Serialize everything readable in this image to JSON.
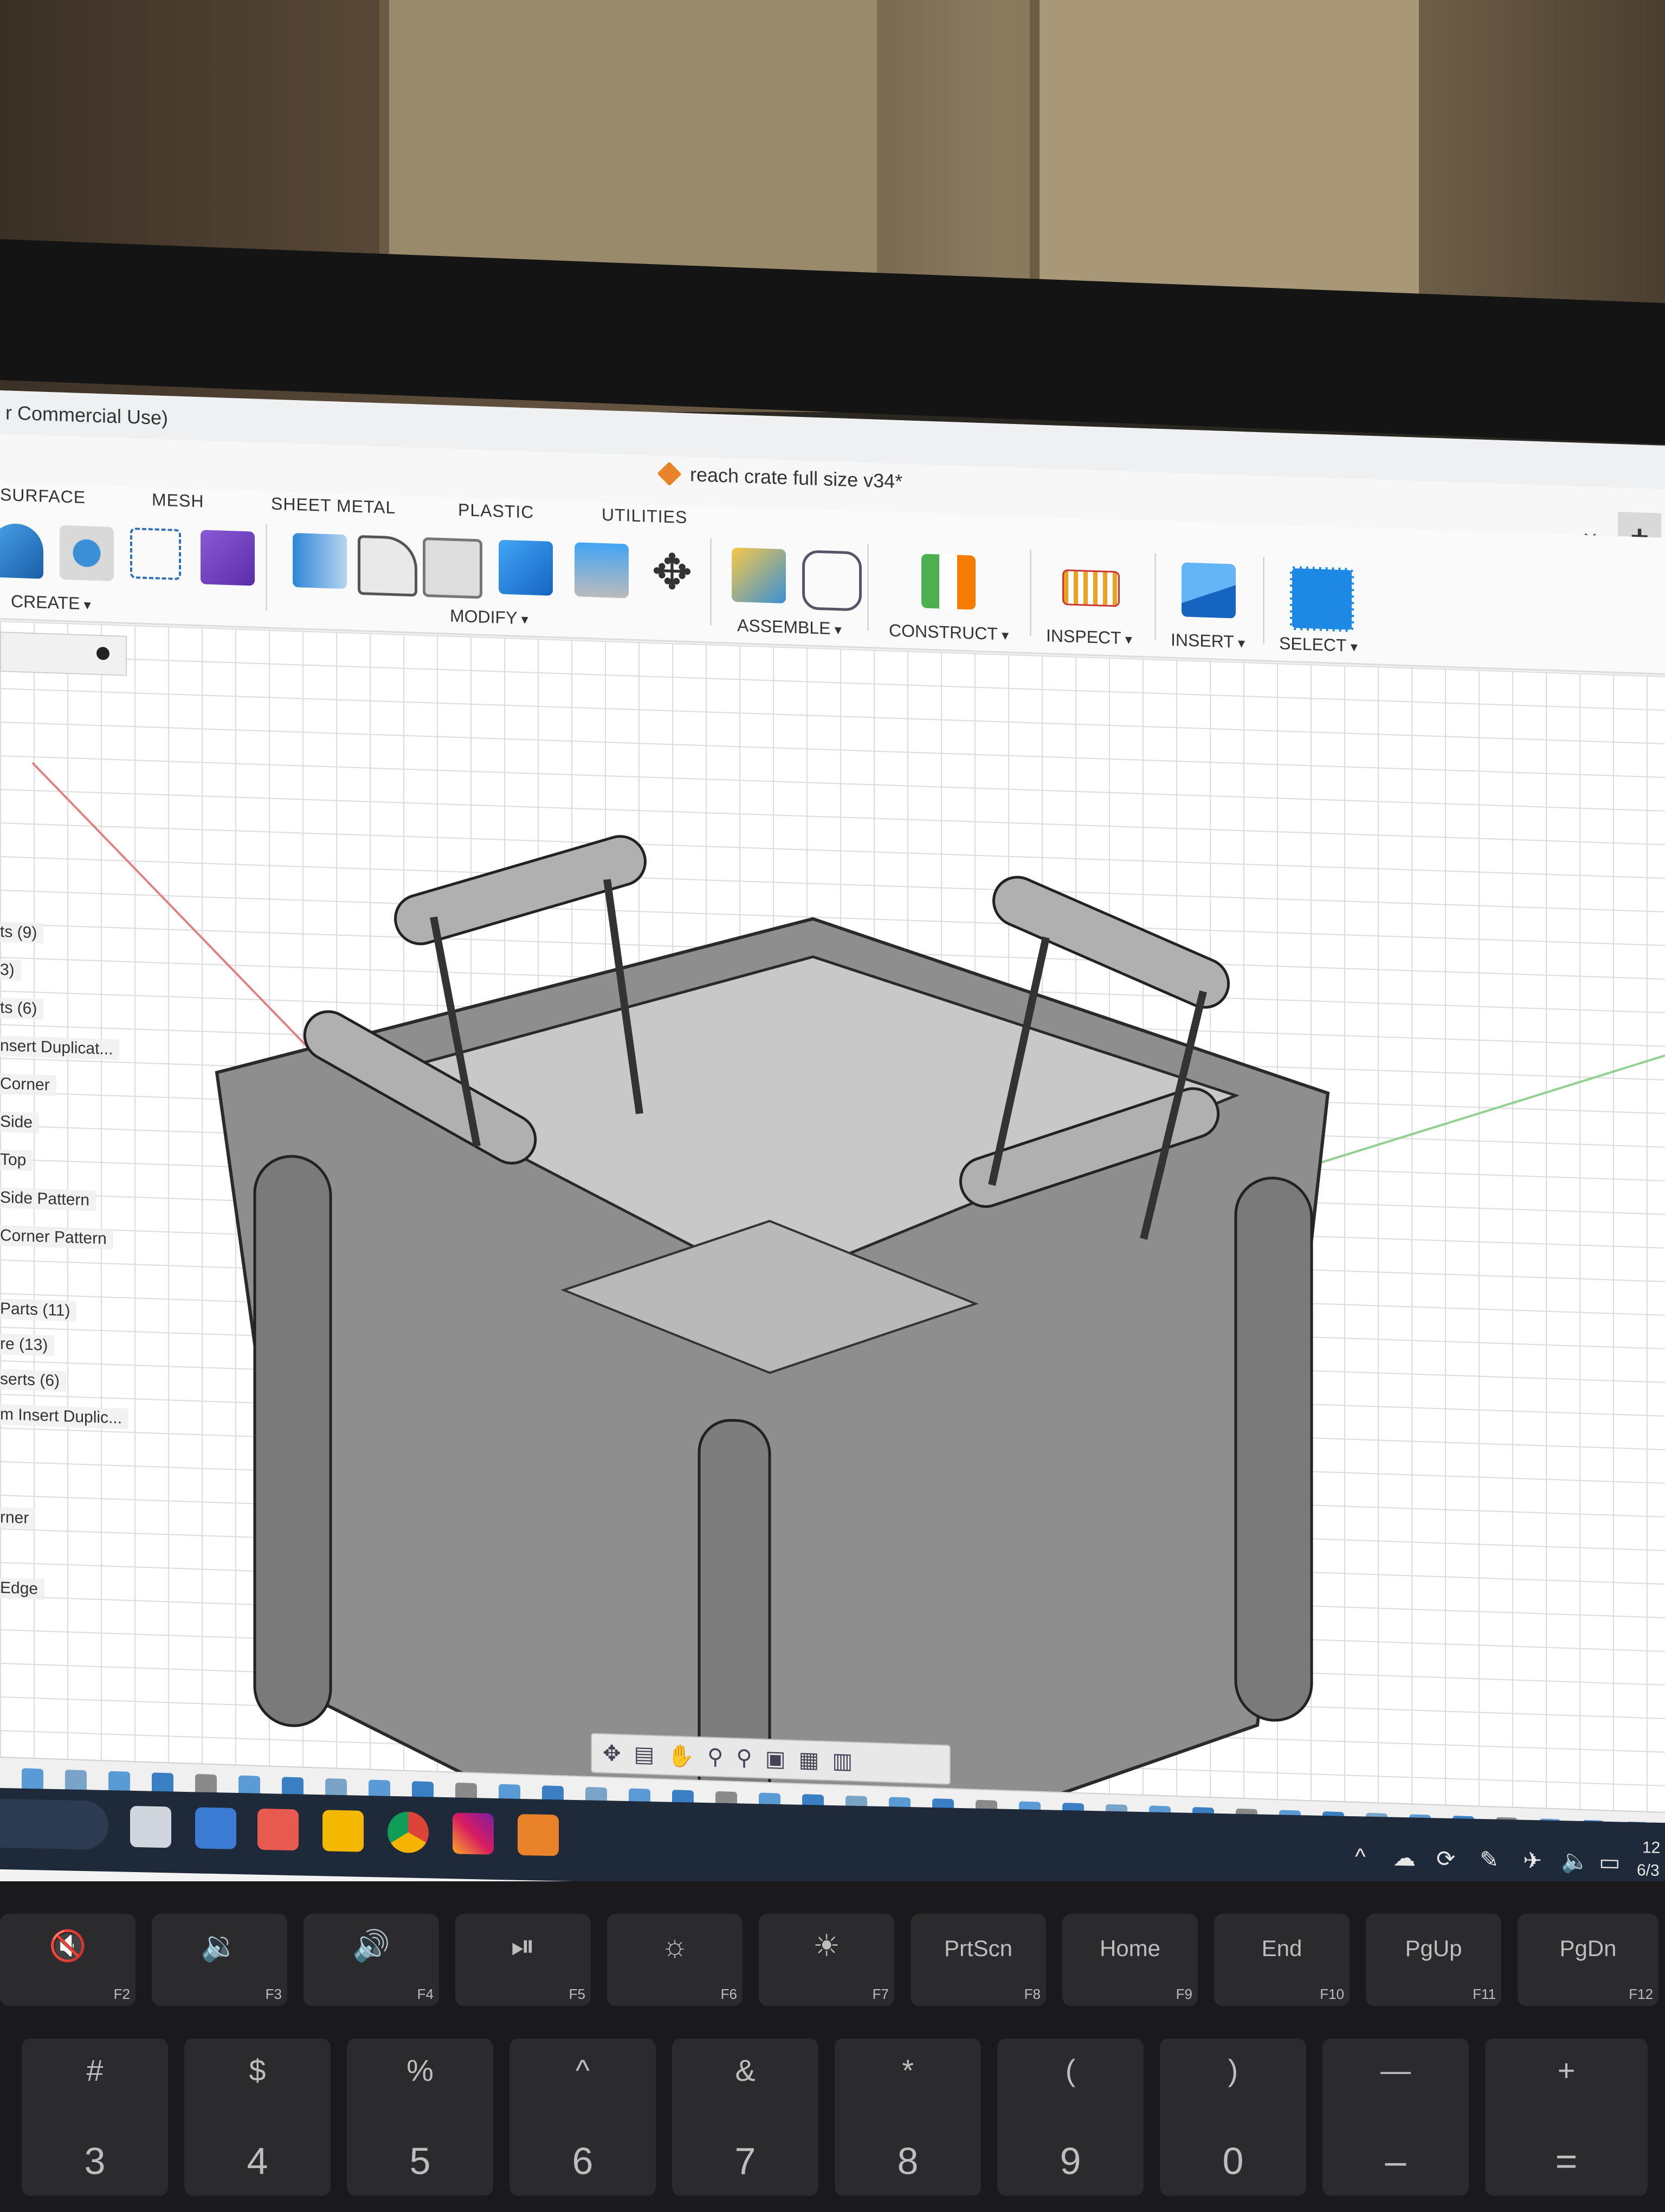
{
  "window": {
    "title_fragment": "r Commercial Use)",
    "document_tab": "reach crate full size v34*",
    "close_glyph": "×",
    "new_tab_glyph": "+"
  },
  "ribbon": {
    "tabs": [
      "SURFACE",
      "MESH",
      "SHEET METAL",
      "PLASTIC",
      "UTILITIES"
    ],
    "groups": {
      "create": "CREATE",
      "modify": "MODIFY",
      "assemble": "ASSEMBLE",
      "construct": "CONSTRUCT",
      "inspect": "INSPECT",
      "insert": "INSERT",
      "select": "SELECT"
    }
  },
  "browser": {
    "items": [
      "ts (9)",
      "3)",
      "ts (6)",
      "nsert Duplicat...",
      "Corner",
      "Side",
      "Top",
      "Side Pattern",
      "Corner Pattern",
      "Parts (11)",
      "re (13)",
      "serts (6)",
      "m Insert Duplic...",
      "rner",
      "Edge"
    ]
  },
  "navbar": {
    "icons": [
      "orbit-icon",
      "look-at-icon",
      "pan-icon",
      "zoom-icon",
      "fit-icon",
      "display-icon",
      "grid-icon",
      "viewport-icon"
    ]
  },
  "keyboard": {
    "fn_row": [
      {
        "glyph": "🔇",
        "fn": "F2"
      },
      {
        "glyph": "🔉",
        "fn": "F3"
      },
      {
        "glyph": "🔊",
        "fn": "F4"
      },
      {
        "glyph": "⏯",
        "fn": "F5"
      },
      {
        "glyph": "☼",
        "fn": "F6"
      },
      {
        "glyph": "☀",
        "fn": "F7"
      },
      {
        "glyph": "PrtScn",
        "fn": "F8"
      },
      {
        "glyph": "Home",
        "fn": "F9"
      },
      {
        "glyph": "End",
        "fn": "F10"
      },
      {
        "glyph": "PgUp",
        "fn": "F11"
      },
      {
        "glyph": "PgDn",
        "fn": "F12"
      }
    ],
    "num_row": [
      {
        "top": "#",
        "bot": "3"
      },
      {
        "top": "$",
        "bot": "4"
      },
      {
        "top": "%",
        "bot": "5"
      },
      {
        "top": "^",
        "bot": "6"
      },
      {
        "top": "&",
        "bot": "7"
      },
      {
        "top": "*",
        "bot": "8"
      },
      {
        "top": "(",
        "bot": "9"
      },
      {
        "top": ")",
        "bot": "0"
      },
      {
        "top": "—",
        "bot": "–"
      },
      {
        "top": "+",
        "bot": "="
      }
    ]
  },
  "taskbar": {
    "clock_fragment": "12",
    "date_fragment": "6/3"
  },
  "colors": {
    "accent_blue": "#1e88e5",
    "fusion_orange": "#e8832a",
    "model_gray": "#8e8e8e"
  }
}
